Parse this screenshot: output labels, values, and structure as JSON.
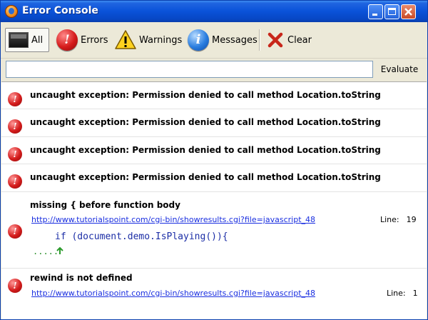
{
  "window": {
    "title": "Error Console"
  },
  "toolbar": {
    "all_label": "All",
    "errors_label": "Errors",
    "warnings_label": "Warnings",
    "messages_label": "Messages",
    "clear_label": "Clear"
  },
  "evaluate": {
    "input_value": "",
    "button_label": "Evaluate"
  },
  "messages": [
    {
      "type": "error",
      "text": "uncaught exception: Permission denied to call method Location.toString"
    },
    {
      "type": "error",
      "text": "uncaught exception: Permission denied to call method Location.toString"
    },
    {
      "type": "error",
      "text": "uncaught exception: Permission denied to call method Location.toString"
    },
    {
      "type": "error",
      "text": "uncaught exception: Permission denied to call method Location.toString"
    },
    {
      "type": "error",
      "text": "missing { before function body",
      "source": "http://www.tutorialspoint.com/cgi-bin/showresults.cgi?file=javascript_48",
      "line_label": "Line:",
      "line_number": "19",
      "code": "if (document.demo.IsPlaying()){",
      "code_marker": "....."
    },
    {
      "type": "error",
      "text": "rewind is not defined",
      "source": "http://www.tutorialspoint.com/cgi-bin/showresults.cgi?file=javascript_48",
      "line_label": "Line:",
      "line_number": "1"
    }
  ],
  "colors": {
    "titlebar": "#0a52d9",
    "link": "#1a2fe0",
    "code": "#1c2ea6",
    "error": "#d61b1b"
  },
  "icons": {
    "app": "firefox-icon",
    "all": "console-icon",
    "errors": "error-icon",
    "warnings": "warning-icon",
    "messages": "info-icon",
    "clear": "clear-x-icon"
  }
}
